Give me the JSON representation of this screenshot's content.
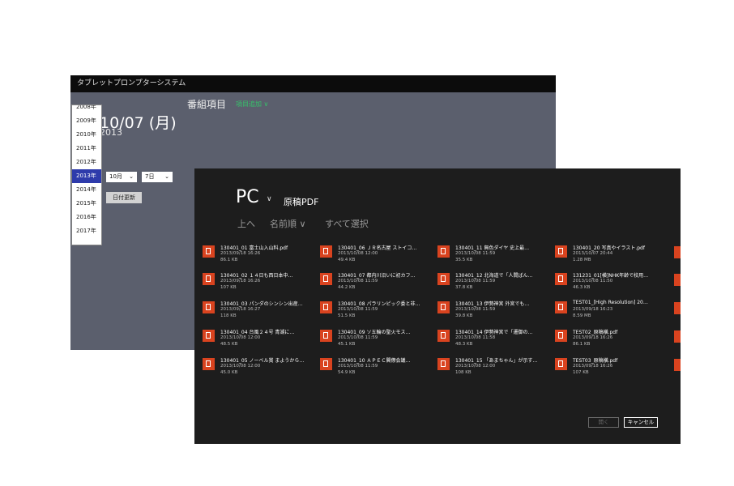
{
  "back_window": {
    "title": "タブレットプロンプターシステム",
    "date": "10/07 (月)",
    "year_text": "2013",
    "program_label": "番組項目",
    "add_item": "項目追加 ∨",
    "year_list": {
      "items": [
        "2008年",
        "2009年",
        "2010年",
        "2011年",
        "2012年",
        "2013年",
        "2014年",
        "2015年",
        "2016年",
        "2017年"
      ],
      "selected": "2013年"
    },
    "month_select": {
      "value": "10月",
      "chevron": "⌄"
    },
    "day_select": {
      "value": "7日",
      "chevron": "⌄"
    },
    "update_button": "日付更新"
  },
  "file_picker": {
    "location": "PC",
    "location_chevron": "∨",
    "folder": "原稿PDF",
    "commands": {
      "up": "上へ",
      "sort": "名前順 ∨",
      "select_all": "すべて選択"
    },
    "files": [
      {
        "name": "130401_01 富士山入山料.pdf",
        "date": "2013/09/18 16:26",
        "size": "86.1 KB"
      },
      {
        "name": "130401_02 １４日も西日本中…",
        "date": "2013/09/18 16:26",
        "size": "107 KB"
      },
      {
        "name": "130401_03 パンダのシンシン出産…",
        "date": "2013/09/18 16:27",
        "size": "118 KB"
      },
      {
        "name": "130401_04 台風２４号 青湖に…",
        "date": "2013/10/08 12:00",
        "size": "48.5 KB"
      },
      {
        "name": "130401_05 ノーベル賞 まようから…",
        "date": "2013/10/08 12:00",
        "size": "45.0 KB"
      },
      {
        "name": "130401_06 ＪＲ名古屋 ストイコ…",
        "date": "2013/10/08 12:00",
        "size": "49.4 KB"
      },
      {
        "name": "130401_07 都内川沿いに初カフ…",
        "date": "2013/10/08 11:59",
        "size": "44.2 KB"
      },
      {
        "name": "130401_08 パラリンピック委と非…",
        "date": "2013/10/08 11:59",
        "size": "51.5 KB"
      },
      {
        "name": "130401_09 ソ五輪の聖火モス…",
        "date": "2013/10/08 11:59",
        "size": "45.1 KB"
      },
      {
        "name": "130401_10 ＡＰＥＣ閣僚会議…",
        "date": "2013/10/08 11:59",
        "size": "54.9 KB"
      },
      {
        "name": "130401_11 無色ダイヤ 史上最…",
        "date": "2013/10/08 11:59",
        "size": "35.5 KB"
      },
      {
        "name": "130401_12 北海道で「人間ばん…",
        "date": "2013/10/08 11:59",
        "size": "37.8 KB"
      },
      {
        "name": "130401_13 伊勢神宮 外宮でも…",
        "date": "2013/10/08 11:59",
        "size": "39.8 KB"
      },
      {
        "name": "130401_14 伊勢神宮で「遷御の…",
        "date": "2013/10/08 11:58",
        "size": "48.3 KB"
      },
      {
        "name": "130401_15 「あまちゃん」が示す…",
        "date": "2013/10/08 12:00",
        "size": "108 KB"
      },
      {
        "name": "130401_20 写真やイラスト.pdf",
        "date": "2013/10/07 20:44",
        "size": "1.28 MB"
      },
      {
        "name": "131231_01[横]NHK年齢で校用…",
        "date": "2013/10/08 11:50",
        "size": "46.3 KB"
      },
      {
        "name": "TEST01_[High Resolution] 20…",
        "date": "2013/09/18 16:23",
        "size": "8.59 MB"
      },
      {
        "name": "TEST02_原稿横.pdf",
        "date": "2013/09/18 16:26",
        "size": "86.1 KB"
      },
      {
        "name": "TEST03_原稿横.pdf",
        "date": "2013/09/18 16:26",
        "size": "107 KB"
      }
    ],
    "open_button": "開く",
    "cancel_button": "キャンセル"
  },
  "colors": {
    "back_bg": "#5b5f6d",
    "front_bg": "#1d1d1d",
    "accent": "#2e3bab",
    "pdf_icon": "#d9431f",
    "add_link": "#36c36a"
  },
  "icons": {
    "file": "pdf-file-icon"
  }
}
